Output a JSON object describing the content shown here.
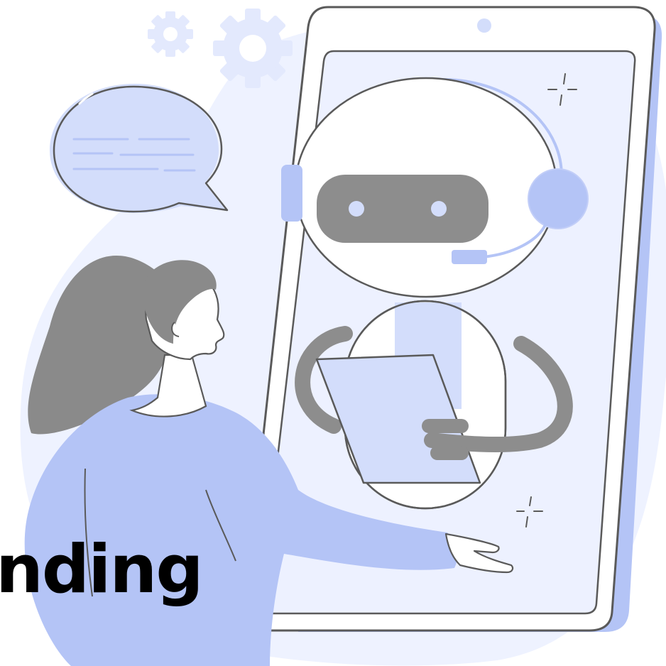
{
  "headline": {
    "text": "nding"
  },
  "palette": {
    "bg_blob": "#eef2ff",
    "accent_light": "#d3ddfb",
    "accent": "#b4c4f6",
    "accent_mid": "#c2cef8",
    "screen": "#edf1ff",
    "outline": "#5a5a5a",
    "robot_face": "#8d8d8d",
    "hair": "#8a8a8a",
    "skin": "#ffffff"
  },
  "icons": {
    "gear_small": "gear-icon",
    "gear_large": "gear-icon",
    "chat_bubble": "speech-bubble-icon",
    "sparkle": "sparkle-icon"
  }
}
